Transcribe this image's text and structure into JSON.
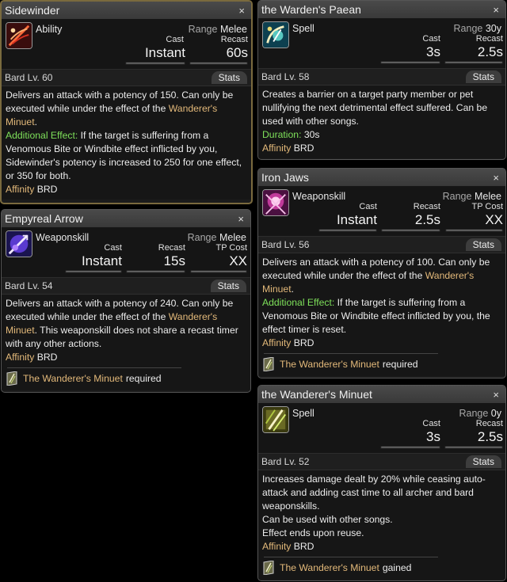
{
  "colors": {
    "highlight": "#e3b97a",
    "effect_label": "#7ee05a",
    "title_bar": "#434343"
  },
  "sidewinder": {
    "title": "Sidewinder",
    "close": "×",
    "icon": "sidewinder-icon",
    "type": "Ability",
    "range_label": "Range",
    "range": "Melee",
    "cast_label": "Cast",
    "cast": "Instant",
    "recast_label": "Recast",
    "recast": "60s",
    "level": "Bard Lv. 60",
    "stats_tab": "Stats",
    "d1": "Delivers an attack with a potency of 150. Can only be executed while under the effect of the ",
    "d1_hl": "Wanderer's Minuet",
    "d1_end": ".",
    "effect_label": "Additional Effect:",
    "d2": " If the target is suffering from a Venomous Bite or Windbite effect inflicted by you, Sidewinder's potency is increased to 250 for one effect, or 350 for both.",
    "affinity_label": "Affinity",
    "affinity": "BRD"
  },
  "empyreal": {
    "title": "Empyreal Arrow",
    "close": "×",
    "icon": "empyreal-arrow-icon",
    "type": "Weaponskill",
    "range_label": "Range",
    "range": "Melee",
    "cast_label": "Cast",
    "cast": "Instant",
    "recast_label": "Recast",
    "recast": "15s",
    "tp_label": "TP Cost",
    "tp": "XX",
    "level": "Bard Lv. 54",
    "stats_tab": "Stats",
    "d1": "Delivers an attack with a potency of 240. Can only be executed while under the effect of the ",
    "d1_hl": "Wanderer's Minuet",
    "d1_end": ". This weaponskill does not share a recast timer with any other actions.",
    "affinity_label": "Affinity",
    "affinity": "BRD",
    "req_icon": "wanderers-minuet-icon",
    "req_name": "The Wanderer's Minuet",
    "req_status": "required"
  },
  "paean": {
    "title": "the Warden's Paean",
    "close": "×",
    "icon": "wardens-paean-icon",
    "type": "Spell",
    "range_label": "Range",
    "range": "30y",
    "cast_label": "Cast",
    "cast": "3s",
    "recast_label": "Recast",
    "recast": "2.5s",
    "level": "Bard Lv. 58",
    "stats_tab": "Stats",
    "d1": "Creates a barrier on a target party member or pet nullifying the next detrimental effect suffered. Can be used with other songs.",
    "duration_label": "Duration:",
    "duration": " 30s",
    "affinity_label": "Affinity",
    "affinity": "BRD"
  },
  "ironjaws": {
    "title": "Iron Jaws",
    "close": "×",
    "icon": "iron-jaws-icon",
    "type": "Weaponskill",
    "range_label": "Range",
    "range": "Melee",
    "cast_label": "Cast",
    "cast": "Instant",
    "recast_label": "Recast",
    "recast": "2.5s",
    "tp_label": "TP Cost",
    "tp": "XX",
    "level": "Bard Lv. 56",
    "stats_tab": "Stats",
    "d1": "Delivers an attack with a potency of 100. Can only be executed while under the effect of the ",
    "d1_hl": "Wanderer's Minuet",
    "d1_end": ".",
    "effect_label": "Additional Effect:",
    "d2": " If the target is suffering from a Venomous Bite or Windbite effect inflicted by you, the effect timer is reset.",
    "affinity_label": "Affinity",
    "affinity": "BRD",
    "req_icon": "wanderers-minuet-icon",
    "req_name": "The Wanderer's Minuet",
    "req_status": "required"
  },
  "minuet": {
    "title": "the Wanderer's Minuet",
    "close": "×",
    "icon": "wanderers-minuet-icon",
    "type": "Spell",
    "range_label": "Range",
    "range": "0y",
    "cast_label": "Cast",
    "cast": "3s",
    "recast_label": "Recast",
    "recast": "2.5s",
    "level": "Bard Lv. 52",
    "stats_tab": "Stats",
    "d1": "Increases damage dealt by 20% while ceasing auto-attack and adding cast time to all archer and bard weaponskills.",
    "d2": "Can be used with other songs.",
    "d3": "Effect ends upon reuse.",
    "affinity_label": "Affinity",
    "affinity": "BRD",
    "req_icon": "wanderers-minuet-icon",
    "req_name": "The Wanderer's Minuet",
    "req_status": "gained"
  }
}
